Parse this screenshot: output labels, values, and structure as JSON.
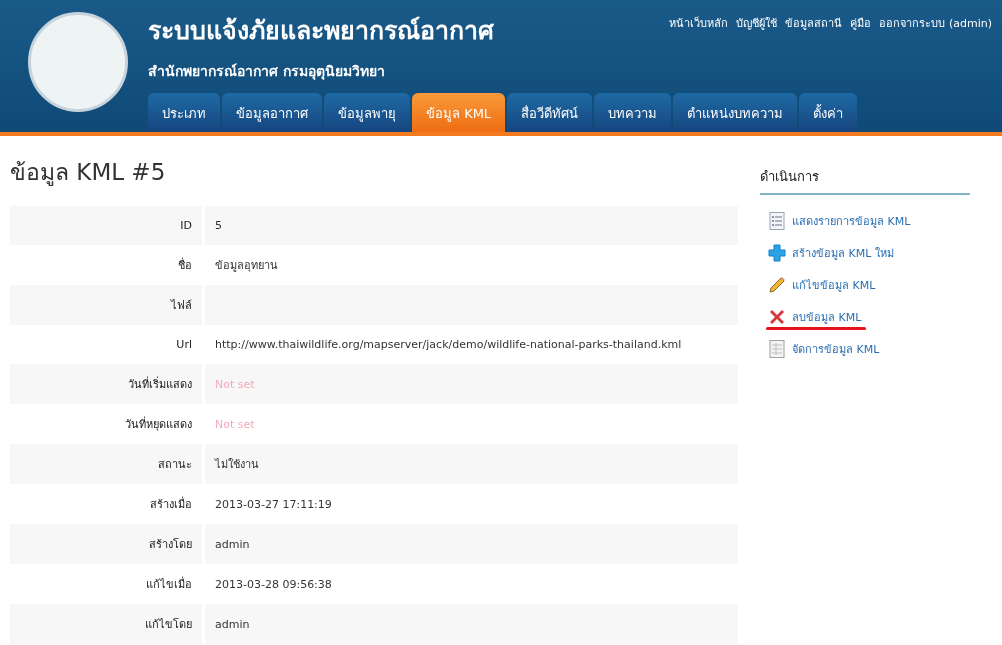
{
  "header": {
    "title": "ระบบแจ้งภัยและพยากรณ์อากาศ",
    "subtitle": "สำนักพยากรณ์อากาศ กรมอุตุนิยมวิทยา",
    "top_links": [
      "หน้าเว็บหลัก",
      "บัญชีผู้ใช้",
      "ข้อมูลสถานี",
      "คู่มือ",
      "ออกจากระบบ (admin)"
    ]
  },
  "tabs": [
    {
      "label": "ประเภท",
      "selected": false
    },
    {
      "label": "ข้อมูลอากาศ",
      "selected": false
    },
    {
      "label": "ข้อมูลพายุ",
      "selected": false
    },
    {
      "label": "ข้อมูล KML",
      "selected": true
    },
    {
      "label": "สื่อวีดีทัศน์",
      "selected": false
    },
    {
      "label": "บทความ",
      "selected": false
    },
    {
      "label": "ตำแหน่งบทความ",
      "selected": false
    },
    {
      "label": "ตั้งค่า",
      "selected": false
    }
  ],
  "page_title": "ข้อมูล KML #5",
  "details": [
    {
      "label": "ID",
      "value": "5",
      "kind": "value"
    },
    {
      "label": "ชื่อ",
      "value": "ข้อมูลอุทยาน",
      "kind": "value"
    },
    {
      "label": "ไฟล์",
      "kind": "value"
    },
    {
      "label": "Url",
      "value": "http://www.thaiwildlife.org/mapserver/jack/demo/wildlife-national-parks-thailand.kml",
      "kind": "value"
    },
    {
      "label": "วันที่เริ่มแสดง",
      "value": "Not set",
      "kind": "not_set"
    },
    {
      "label": "วันที่หยุดแสดง",
      "value": "Not set",
      "kind": "not_set"
    },
    {
      "label": "สถานะ",
      "value": "ไม่ใช้งาน",
      "kind": "value"
    },
    {
      "label": "สร้างเมื่อ",
      "value": "2013-03-27 17:11:19",
      "kind": "value"
    },
    {
      "label": "สร้างโดย",
      "value": "admin",
      "kind": "value"
    },
    {
      "label": "แก้ไขเมื่อ",
      "value": "2013-03-28 09:56:38",
      "kind": "value"
    },
    {
      "label": "แก้ไขโดย",
      "value": "admin",
      "kind": "value"
    }
  ],
  "operations": {
    "title": "ดำเนินการ",
    "items": [
      {
        "label": "แสดงรายการข้อมูล KML",
        "kind": "list",
        "underlined": false
      },
      {
        "label": "สร้างข้อมูล KML ใหม่",
        "kind": "create",
        "underlined": false
      },
      {
        "label": "แก้ไขข้อมูล KML",
        "kind": "edit",
        "underlined": false
      },
      {
        "label": "ลบข้อมูล KML",
        "kind": "delete",
        "underlined": true
      },
      {
        "label": "จัดการข้อมูล KML",
        "kind": "manage",
        "underlined": false
      }
    ]
  }
}
